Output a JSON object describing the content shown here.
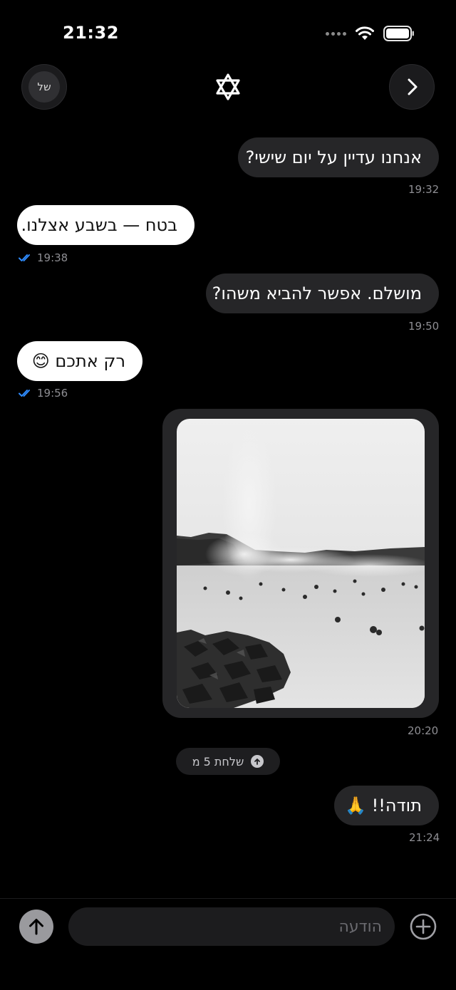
{
  "status_bar": {
    "time": "21:32"
  },
  "header": {
    "avatar_initials": "של"
  },
  "messages": [
    {
      "direction": "outgoing",
      "text": "אנחנו עדיין על יום שישי?",
      "time": "19:32"
    },
    {
      "direction": "incoming",
      "text": "בטח — בשבע אצלנו.",
      "time": "19:38"
    },
    {
      "direction": "outgoing",
      "text": "מושלם. אפשר להביא משהו?",
      "time": "19:50"
    },
    {
      "direction": "incoming",
      "text": "רק אתכם 😊",
      "time": "19:56"
    },
    {
      "direction": "outgoing",
      "type": "photo",
      "time": "20:20"
    },
    {
      "direction": "outgoing",
      "text": "תודה!! 🙏",
      "time": "21:24"
    }
  ],
  "sent_pill": {
    "label": "שלחת 5 מ"
  },
  "composer": {
    "placeholder": "הודעה"
  },
  "colors": {
    "outgoing_bubble": "#262628",
    "incoming_bubble": "#ffffff",
    "read_check": "#2f8cff"
  },
  "icons": [
    "wifi-icon",
    "battery-icon",
    "star-of-david-icon",
    "chevron-right-icon",
    "double-check-icon",
    "arrow-up-icon",
    "plus-circle-icon"
  ]
}
